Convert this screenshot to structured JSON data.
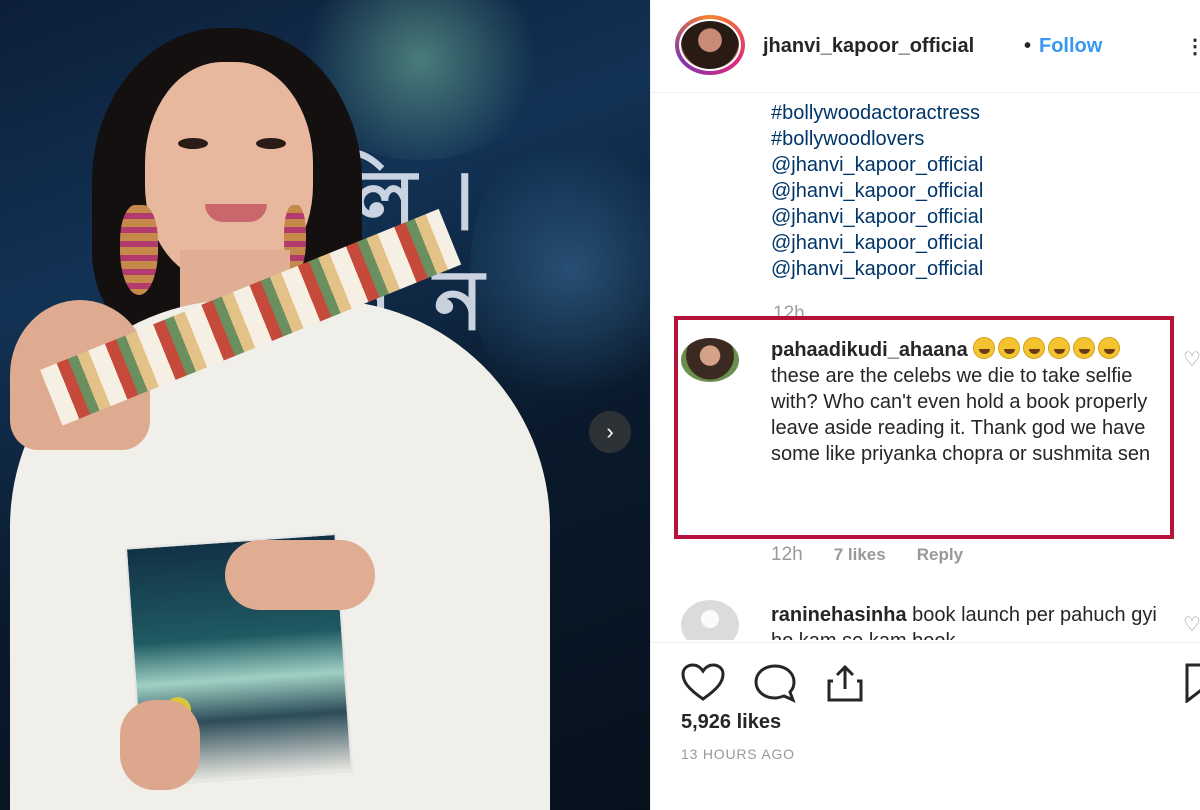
{
  "post": {
    "username": "jhanvi_kapoor_official",
    "separator": "•",
    "follow_label": "Follow",
    "more_label": "⋮",
    "next_label": "›"
  },
  "caption": {
    "lines": [
      "#bollywoodactoractress",
      "#bollywoodlovers",
      "@jhanvi_kapoor_official",
      "@jhanvi_kapoor_official",
      "@jhanvi_kapoor_official",
      "@jhanvi_kapoor_official",
      "@jhanvi_kapoor_official"
    ],
    "time": "12h"
  },
  "highlighted_comment": {
    "username": "pahaadikudi_ahaana",
    "emoji_count": 6,
    "text": "these are the celebs we die to take selfie with? Who can't even hold a book properly leave aside reading it. Thank god we have some like priyanka chopra or sushmita sen",
    "time": "12h",
    "likes": "7 likes",
    "reply_label": "Reply",
    "highlight_color": "#b5123a"
  },
  "comment2": {
    "username": "raninehasinha",
    "text": "book launch per pahuch gyi ho kam se kam book"
  },
  "actions": {
    "like_icon": "heart-icon",
    "comment_icon": "comment-icon",
    "share_icon": "share-icon",
    "save_icon": "bookmark-icon"
  },
  "stats": {
    "likes": "5,926 likes",
    "time_ago": "13 HOURS AGO"
  },
  "colors": {
    "link": "#3897f0",
    "hashtag": "#003569",
    "muted": "#999999"
  }
}
